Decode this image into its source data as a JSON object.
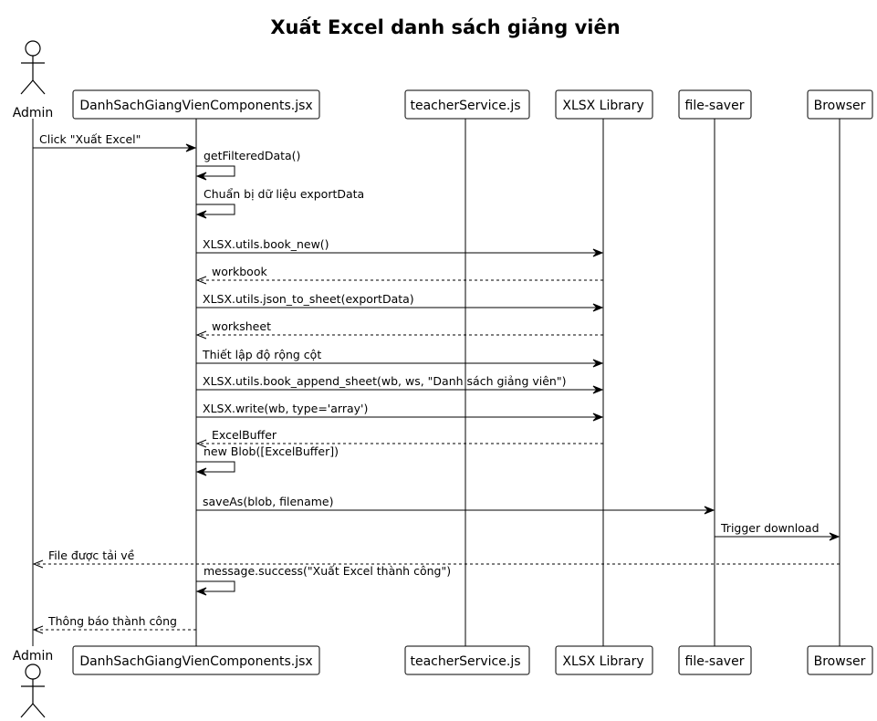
{
  "title": "Xuất Excel danh sách giảng viên",
  "participants": [
    {
      "id": "admin",
      "label": "Admin",
      "kind": "actor"
    },
    {
      "id": "comp",
      "label": "DanhSachGiangVienComponents.jsx",
      "kind": "box"
    },
    {
      "id": "svc",
      "label": "teacherService.js",
      "kind": "box"
    },
    {
      "id": "xlsx",
      "label": "XLSX Library",
      "kind": "box"
    },
    {
      "id": "saver",
      "label": "file-saver",
      "kind": "box"
    },
    {
      "id": "browser",
      "label": "Browser",
      "kind": "box"
    }
  ],
  "messages": [
    {
      "from": "admin",
      "to": "comp",
      "label": "Click \"Xuất Excel\"",
      "style": "solid"
    },
    {
      "from": "comp",
      "to": "comp",
      "label": "getFilteredData()",
      "style": "solid"
    },
    {
      "from": "comp",
      "to": "comp",
      "label": "Chuẩn bị dữ liệu exportData",
      "style": "solid"
    },
    {
      "from": "comp",
      "to": "xlsx",
      "label": "XLSX.utils.book_new()",
      "style": "solid"
    },
    {
      "from": "xlsx",
      "to": "comp",
      "label": "workbook",
      "style": "dashed"
    },
    {
      "from": "comp",
      "to": "xlsx",
      "label": "XLSX.utils.json_to_sheet(exportData)",
      "style": "solid"
    },
    {
      "from": "xlsx",
      "to": "comp",
      "label": "worksheet",
      "style": "dashed"
    },
    {
      "from": "comp",
      "to": "xlsx",
      "label": "Thiết lập độ rộng cột",
      "style": "solid"
    },
    {
      "from": "comp",
      "to": "xlsx",
      "label": "XLSX.utils.book_append_sheet(wb, ws, \"Danh sách giảng viên\")",
      "style": "solid"
    },
    {
      "from": "comp",
      "to": "xlsx",
      "label": "XLSX.write(wb, type='array')",
      "style": "solid"
    },
    {
      "from": "xlsx",
      "to": "comp",
      "label": "ExcelBuffer",
      "style": "dashed"
    },
    {
      "from": "comp",
      "to": "comp",
      "label": "new Blob([ExcelBuffer])",
      "style": "solid"
    },
    {
      "from": "comp",
      "to": "saver",
      "label": "saveAs(blob, filename)",
      "style": "solid"
    },
    {
      "from": "saver",
      "to": "browser",
      "label": "Trigger download",
      "style": "solid"
    },
    {
      "from": "browser",
      "to": "admin",
      "label": "File được tải về",
      "style": "dashed"
    },
    {
      "from": "comp",
      "to": "comp",
      "label": "message.success(\"Xuất Excel thành công\")",
      "style": "solid"
    },
    {
      "from": "comp",
      "to": "admin",
      "label": "Thông báo thành công",
      "style": "dashed"
    }
  ]
}
